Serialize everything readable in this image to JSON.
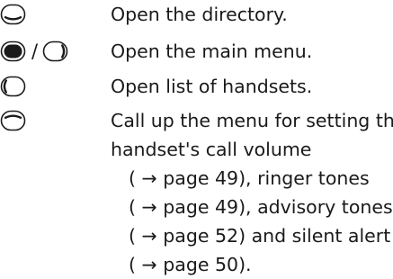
{
  "items": [
    {
      "key_icons": [
        "control-key-down-icon"
      ],
      "text": "Open the directory."
    },
    {
      "key_icons": [
        "end-call-key-icon",
        "control-key-right-icon"
      ],
      "separator": "/",
      "text": "Open the main menu."
    },
    {
      "key_icons": [
        "control-key-left-icon"
      ],
      "text": "Open list of handsets."
    },
    {
      "key_icons": [
        "control-key-up-icon"
      ],
      "lines": [
        "Call up the menu for setting the",
        "handset's call volume"
      ],
      "refs": [
        {
          "arrow": "→",
          "page_text": "page 49",
          "suffix": "), ringer tones"
        },
        {
          "arrow": "→",
          "page_text": "page 49",
          "suffix": "), advisory tones"
        },
        {
          "arrow": "→",
          "page_text": "page 52",
          "suffix": ") and silent alert"
        },
        {
          "arrow": "→",
          "page_text": "page 50",
          "suffix": ")."
        }
      ],
      "ref_open": "("
    }
  ],
  "colors": {
    "text": "#1a1a1a",
    "key_fill": "#1a1a1a"
  }
}
